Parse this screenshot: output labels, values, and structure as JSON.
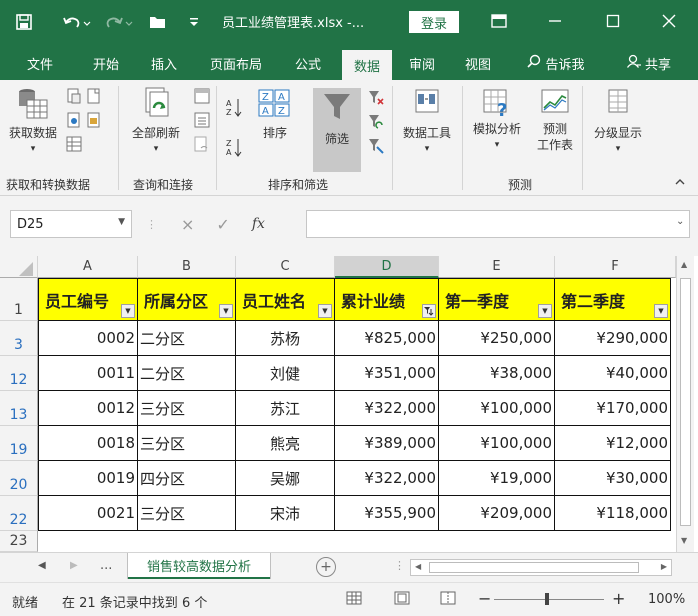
{
  "titlebar": {
    "title": "员工业绩管理表.xlsx -...",
    "login": "登录"
  },
  "menu": [
    "文件",
    "开始",
    "插入",
    "页面布局",
    "公式",
    "数据",
    "审阅",
    "视图",
    "告诉我",
    "共享"
  ],
  "ribbon": {
    "get_data": "获取数据",
    "refresh_all": "全部刷新",
    "sort": "排序",
    "filter": "筛选",
    "data_tools": "数据工具",
    "what_if": "模拟分析",
    "forecast_line1": "预测",
    "forecast_line2": "工作表",
    "outline": "分级显示",
    "groups": {
      "get_transform": "获取和转换数据",
      "queries": "查询和连接",
      "sort_filter": "排序和筛选",
      "forecast": "预测"
    }
  },
  "formula": {
    "namebox": "D25",
    "cancel": "×",
    "confirm": "✓",
    "fx": "fx",
    "value": ""
  },
  "columns": [
    "A",
    "B",
    "C",
    "D",
    "E",
    "F"
  ],
  "headers": [
    "员工编号",
    "所属分区",
    "员工姓名",
    "累计业绩",
    "第一季度",
    "第二季度"
  ],
  "rows": [
    {
      "row": "3",
      "id": "0002",
      "zone": "二分区",
      "name": "苏杨",
      "total": "¥825,000",
      "q1": "¥250,000",
      "q2": "¥290,000"
    },
    {
      "row": "12",
      "id": "0011",
      "zone": "二分区",
      "name": "刘健",
      "total": "¥351,000",
      "q1": "¥38,000",
      "q2": "¥40,000"
    },
    {
      "row": "13",
      "id": "0012",
      "zone": "三分区",
      "name": "苏江",
      "total": "¥322,000",
      "q1": "¥100,000",
      "q2": "¥170,000"
    },
    {
      "row": "19",
      "id": "0018",
      "zone": "三分区",
      "name": "熊亮",
      "total": "¥389,000",
      "q1": "¥100,000",
      "q2": "¥12,000"
    },
    {
      "row": "20",
      "id": "0019",
      "zone": "四分区",
      "name": "吴娜",
      "total": "¥322,000",
      "q1": "¥19,000",
      "q2": "¥30,000"
    },
    {
      "row": "22",
      "id": "0021",
      "zone": "三分区",
      "name": "宋沛",
      "total": "¥355,900",
      "q1": "¥209,000",
      "q2": "¥118,000"
    }
  ],
  "row_labels": {
    "header": "1",
    "last": "23"
  },
  "sheet": {
    "ellipsis": "...",
    "active_tab": "销售较高数据分析",
    "add": "+"
  },
  "status": {
    "ready": "就绪",
    "message": "在 21 条记录中找到 6 个",
    "zoom": "100%",
    "zoom_minus": "−",
    "zoom_plus": "+"
  },
  "colors": {
    "brand": "#217346",
    "header_fill": "#ffff00",
    "row_number": "#2a6fbf"
  }
}
